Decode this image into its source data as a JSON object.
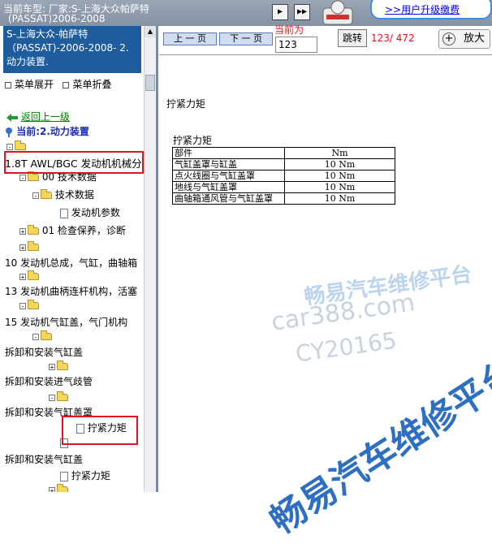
{
  "topbar": {
    "car_line": "当前车型:  厂家:S-上海大众帕萨特",
    "car_line2": "(PASSAT)2006-2008",
    "upgrade_link": ">>用户升级缴费"
  },
  "sidebar": {
    "current_model": "S-上海大众-帕萨特（PASSAT)-2006-2008- 2.动力装置.",
    "menu_expand": "菜单展开",
    "menu_collapse": "菜单折叠",
    "back": "返回上一级",
    "current": "当前:2.动力装置",
    "tree": [
      "1.8T AWL/BGC 发动机机械分",
      "00 技术数据",
      "技术数据",
      "发动机参数",
      "01 检查保养，诊断",
      "10 发动机总成，气缸，曲轴箱",
      "13 发动机曲柄连杆机构，活塞",
      "15 发动机气缸盖，气门机构",
      "拆卸和安装气缸盖",
      "拆卸和安装进气歧管",
      "拆卸和安装气缸盖罩",
      "拧紧力矩",
      "拆卸和安装气缸盖",
      "拧紧力矩"
    ]
  },
  "toolbar": {
    "prev_page": "上 一 页",
    "next_page": "下 一 页",
    "current_label": "当前为",
    "page_value": "123",
    "jump": "跳转",
    "page_count": "123/ 472",
    "zoom": "放大"
  },
  "document": {
    "title": "拧紧力矩",
    "table_caption": "拧紧力矩",
    "columns": [
      "部件",
      "Nm"
    ],
    "rows": [
      [
        "气缸盖罩与缸盖",
        "10 Nm"
      ],
      [
        "点火线圈与气缸盖罩",
        "10 Nm"
      ],
      [
        "地线与气缸盖罩",
        "10 Nm"
      ],
      [
        "曲轴箱通风管与气缸盖罩",
        "10 Nm"
      ]
    ]
  },
  "watermark": {
    "line1": "畅易汽车维修平台",
    "line2": "car388.com",
    "line3": "CY20165",
    "line4": "畅易汽车维修平台"
  },
  "colors": {
    "accent_red": "#e0141e",
    "sidebar_blue": "#1f5c9e",
    "link_green": "#008000",
    "watermark_blue": "#2e6fc4"
  }
}
